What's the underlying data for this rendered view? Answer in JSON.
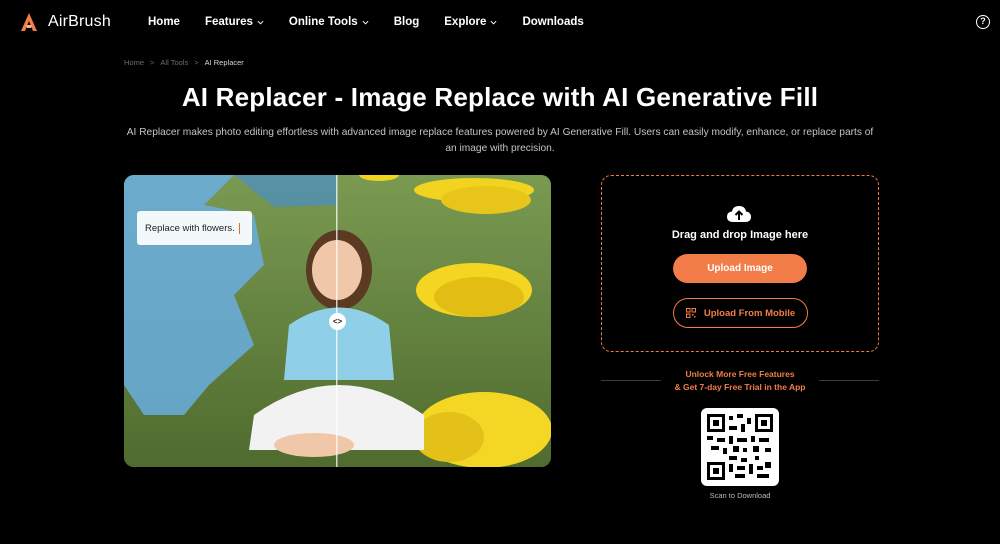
{
  "brand": {
    "name": "AirBrush",
    "accent": "#f27d48"
  },
  "nav": {
    "items": [
      {
        "label": "Home",
        "dropdown": false
      },
      {
        "label": "Features",
        "dropdown": true
      },
      {
        "label": "Online Tools",
        "dropdown": true
      },
      {
        "label": "Blog",
        "dropdown": false
      },
      {
        "label": "Explore",
        "dropdown": true
      },
      {
        "label": "Downloads",
        "dropdown": false
      }
    ],
    "help_icon": "?"
  },
  "breadcrumb": {
    "items": [
      "Home",
      "All Tools",
      "AI Replacer"
    ],
    "separator": ">"
  },
  "page": {
    "title": "AI Replacer - Image Replace with AI Generative Fill",
    "description": "AI Replacer makes photo editing effortless with advanced image replace features powered by AI Generative Fill. Users can easily modify, enhance, or replace parts of an image with precision."
  },
  "preview": {
    "prompt": "Replace with flowers.",
    "handle_icon": "<>"
  },
  "upload": {
    "drag_text": "Drag and drop Image here",
    "upload_button": "Upload Image",
    "mobile_button": "Upload From Mobile"
  },
  "promo": {
    "line1": "Unlock More Free Features",
    "line2": "& Get 7-day Free Trial in the App",
    "scan": "Scan to Download"
  }
}
